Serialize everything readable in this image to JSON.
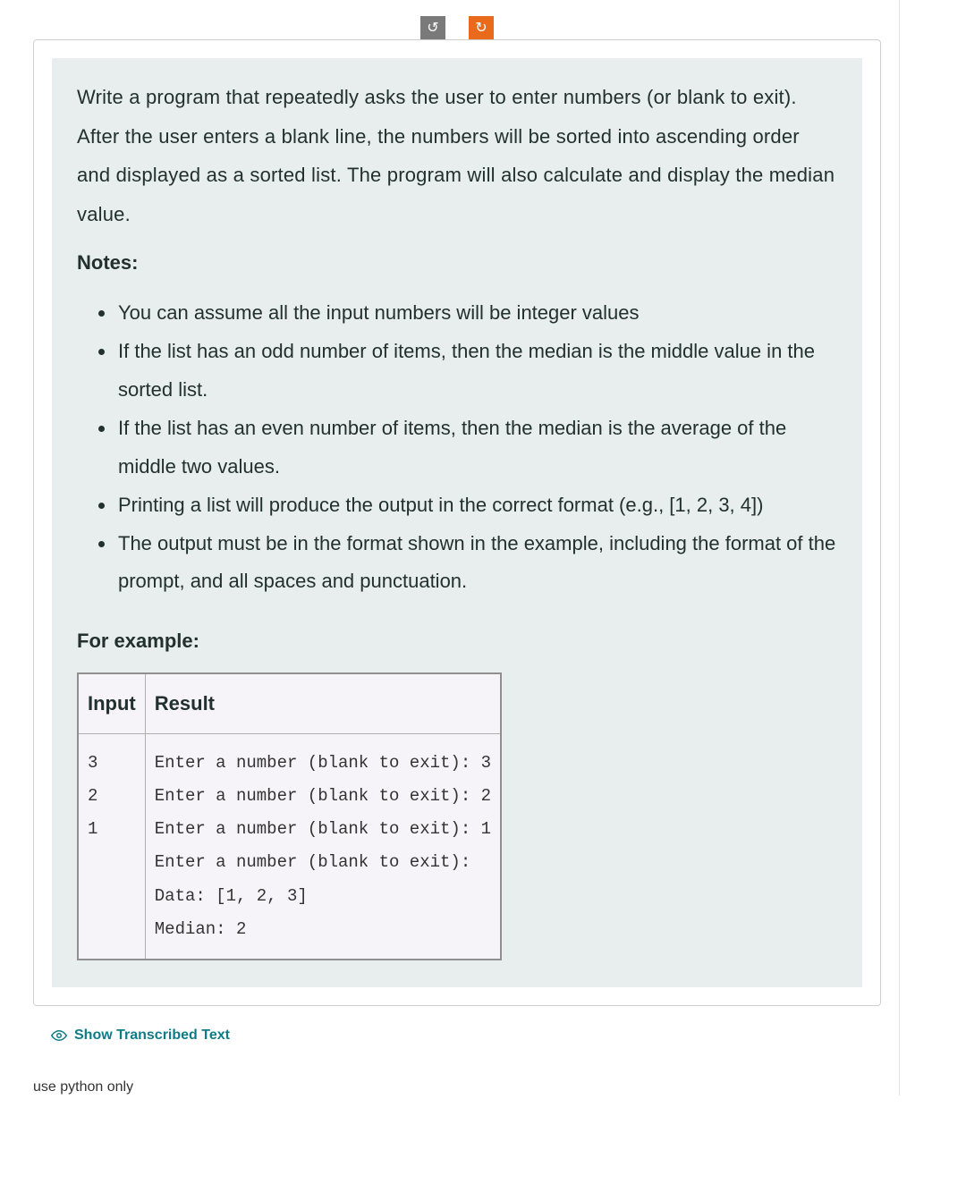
{
  "topButtons": {
    "undoGlyph": "↺",
    "redoGlyph": "↻"
  },
  "question": {
    "intro": "Write a program that repeatedly asks the user to enter numbers (or blank to exit).  After the user enters a blank line, the numbers will be sorted into ascending order and displayed  as a sorted list.  The program will also calculate and display the median value.",
    "notesHeading": "Notes:",
    "notes": [
      "You can assume all the input numbers will be integer values",
      "If the list has an odd number of items, then the median is the middle value in the sorted list.",
      "If the list has an even number of items, then the median is the average of the middle two values.",
      "Printing a list will produce the output in the correct format (e.g., [1, 2, 3, 4])",
      "The output must be in the format shown in the example, including the format of the prompt, and all spaces and punctuation."
    ],
    "exampleHeading": "For example:",
    "table": {
      "headers": {
        "input": "Input",
        "result": "Result"
      },
      "row": {
        "input": "3\n2\n1",
        "result": "Enter a number (blank to exit): 3\nEnter a number (blank to exit): 2\nEnter a number (blank to exit): 1\nEnter a number (blank to exit):\nData: [1, 2, 3]\nMedian: 2"
      }
    }
  },
  "showTranscribed": "Show Transcribed Text",
  "bottomNote": "use python only"
}
